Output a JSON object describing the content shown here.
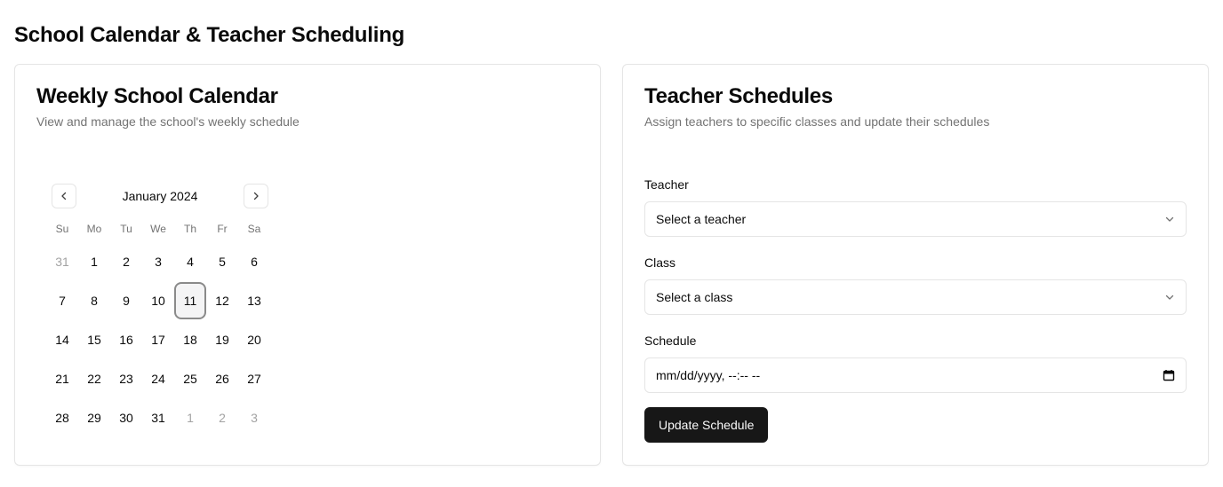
{
  "page": {
    "title": "School Calendar & Teacher Scheduling"
  },
  "calendar_card": {
    "title": "Weekly School Calendar",
    "description": "View and manage the school's weekly schedule",
    "month_label": "January 2024",
    "prev_icon": "chevron-left-icon",
    "next_icon": "chevron-right-icon",
    "weekdays": [
      "Su",
      "Mo",
      "Tu",
      "We",
      "Th",
      "Fr",
      "Sa"
    ],
    "selected_day": "11",
    "days": [
      {
        "label": "31",
        "outside": true
      },
      {
        "label": "1"
      },
      {
        "label": "2"
      },
      {
        "label": "3"
      },
      {
        "label": "4"
      },
      {
        "label": "5"
      },
      {
        "label": "6"
      },
      {
        "label": "7"
      },
      {
        "label": "8"
      },
      {
        "label": "9"
      },
      {
        "label": "10"
      },
      {
        "label": "11",
        "today": true
      },
      {
        "label": "12"
      },
      {
        "label": "13"
      },
      {
        "label": "14"
      },
      {
        "label": "15"
      },
      {
        "label": "16"
      },
      {
        "label": "17"
      },
      {
        "label": "18"
      },
      {
        "label": "19"
      },
      {
        "label": "20"
      },
      {
        "label": "21"
      },
      {
        "label": "22"
      },
      {
        "label": "23"
      },
      {
        "label": "24"
      },
      {
        "label": "25"
      },
      {
        "label": "26"
      },
      {
        "label": "27"
      },
      {
        "label": "28"
      },
      {
        "label": "29"
      },
      {
        "label": "30"
      },
      {
        "label": "31"
      },
      {
        "label": "1",
        "outside": true
      },
      {
        "label": "2",
        "outside": true
      },
      {
        "label": "3",
        "outside": true
      }
    ]
  },
  "schedule_card": {
    "title": "Teacher Schedules",
    "description": "Assign teachers to specific classes and update their schedules",
    "teacher_label": "Teacher",
    "teacher_placeholder": "Select a teacher",
    "class_label": "Class",
    "class_placeholder": "Select a class",
    "schedule_label": "Schedule",
    "schedule_value": "mm/dd/yyyy, --:-- --",
    "button_label": "Update Schedule",
    "dropdown_icon": "chevron-down-icon",
    "date_icon": "calendar-icon"
  },
  "colors": {
    "primary_button": "#171717",
    "border": "#e5e5e5",
    "muted_text": "#737373"
  }
}
